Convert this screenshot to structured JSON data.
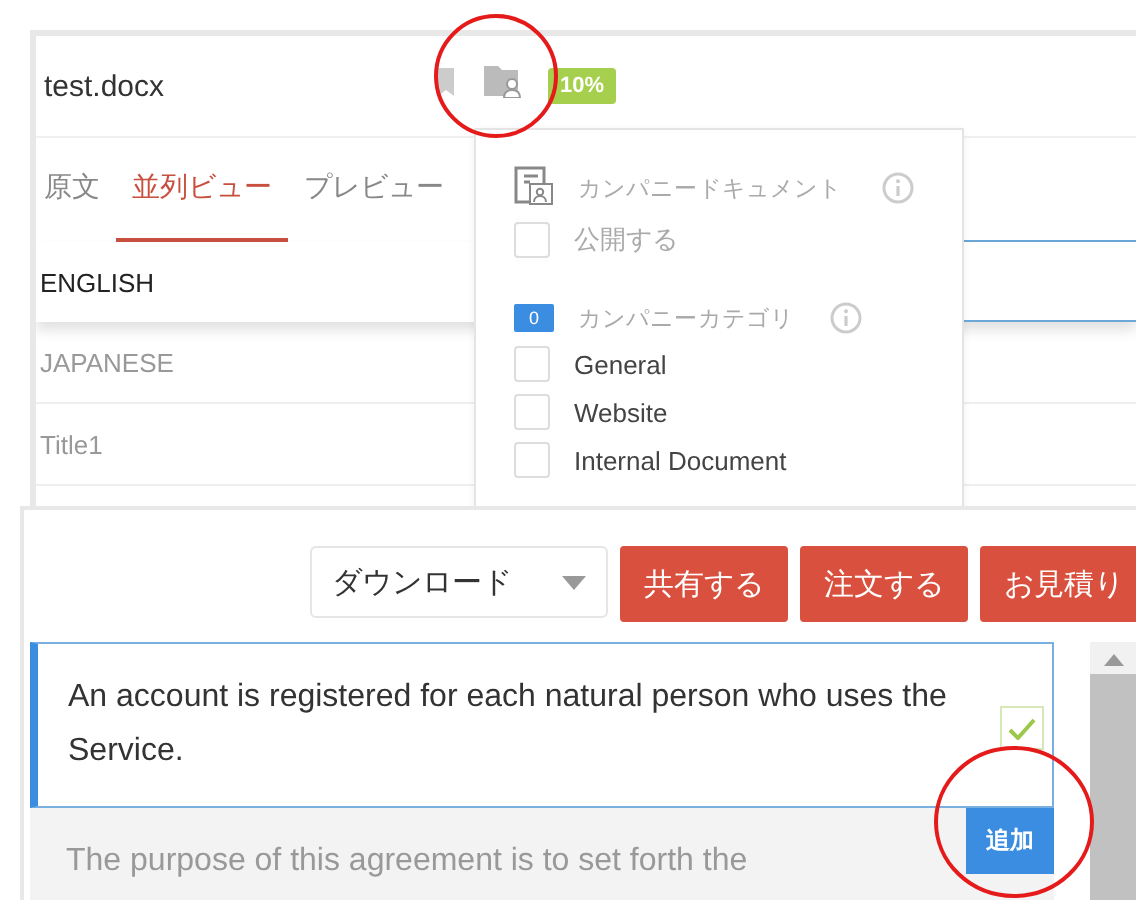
{
  "document": {
    "file_name": "test.docx",
    "progress_badge": "10%"
  },
  "tabs": [
    {
      "label": "原文",
      "selected": false
    },
    {
      "label": "並列ビュー",
      "selected": true
    },
    {
      "label": "プレビュー",
      "selected": false
    }
  ],
  "languages": [
    {
      "label": "ENGLISH",
      "selected": true
    },
    {
      "label": "JAPANESE",
      "selected": false
    }
  ],
  "title_row": "Title1",
  "company_popup": {
    "document_heading": "カンパニードキュメント",
    "publish": {
      "label": "公開する",
      "checked": false
    },
    "category_count": "0",
    "category_heading": "カンパニーカテゴリ",
    "categories": [
      {
        "label": "General",
        "checked": false
      },
      {
        "label": "Website",
        "checked": false
      },
      {
        "label": "Internal Document",
        "checked": false
      }
    ]
  },
  "toolbar": {
    "download": "ダウンロード",
    "buttons": [
      "共有する",
      "注文する",
      "お見積り"
    ]
  },
  "segments": [
    {
      "text": "An account is registered for each natural person who uses the Service.",
      "selected": true,
      "confirmed": true
    },
    {
      "text": "The purpose of this agreement is to set forth the",
      "selected": false,
      "confirmed": false
    }
  ],
  "add_button": "追加"
}
